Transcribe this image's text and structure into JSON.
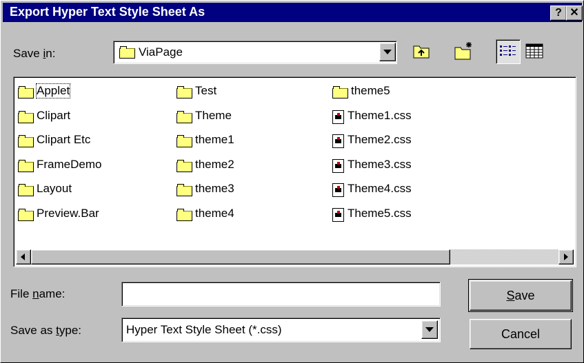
{
  "window": {
    "title": "Export Hyper Text Style Sheet As",
    "help_label": "?",
    "close_label": "✕"
  },
  "save_in": {
    "label_pre": "Save ",
    "label_key": "i",
    "label_post": "n:",
    "value": "ViaPage"
  },
  "toolbar": {
    "up_icon": "up-one-level-icon",
    "new_folder_icon": "new-folder-icon",
    "list_icon": "list-view-icon",
    "details_icon": "details-view-icon"
  },
  "files": {
    "col1": [
      "Applet",
      "Clipart",
      "Clipart Etc",
      "FrameDemo",
      "Layout",
      "Preview.Bar"
    ],
    "col2": [
      "Test",
      "Theme",
      "theme1",
      "theme2",
      "theme3",
      "theme4"
    ],
    "col3": [
      "theme5",
      "Theme1.css",
      "Theme2.css",
      "Theme3.css",
      "Theme4.css",
      "Theme5.css"
    ]
  },
  "file_name": {
    "label_pre": "File ",
    "label_key": "n",
    "label_post": "ame:",
    "value": ""
  },
  "save_type": {
    "label_pre": "Save as ",
    "label_key": "t",
    "label_post": "ype:",
    "value": "Hyper Text Style Sheet (*.css)"
  },
  "buttons": {
    "save_key": "S",
    "save_rest": "ave",
    "cancel": "Cancel"
  }
}
